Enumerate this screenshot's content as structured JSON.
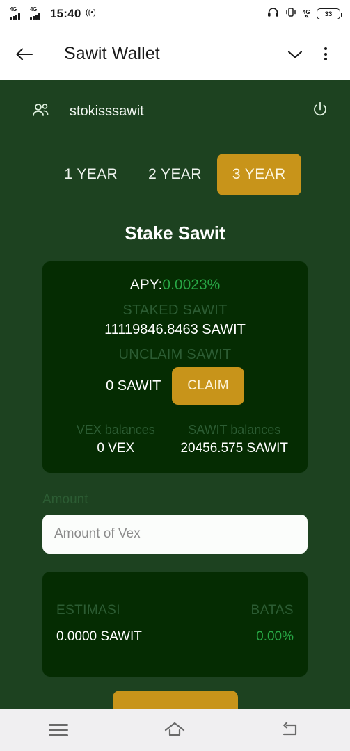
{
  "statusbar": {
    "network_label_1": "4G",
    "network_label_2": "4G",
    "time": "15:40",
    "wifi_icon": "hotspot-icon",
    "headset_icon": "headset-icon",
    "vibrate_icon": "vibrate-icon",
    "data_label": "4G",
    "battery_level": "33"
  },
  "appbar": {
    "back_icon": "back-arrow-icon",
    "title": "Sawit Wallet",
    "chevron_icon": "chevron-down-icon",
    "menu_icon": "kebab-menu-icon"
  },
  "account": {
    "people_icon": "people-icon",
    "name": "stokisssawit",
    "power_icon": "power-icon"
  },
  "tabs": [
    {
      "label": "1 YEAR",
      "active": false
    },
    {
      "label": "2 YEAR",
      "active": false
    },
    {
      "label": "3 YEAR",
      "active": true
    }
  ],
  "section_title": "Stake Sawit",
  "stake_card": {
    "apy_label": "APY:",
    "apy_value": "0.0023%",
    "staked_label": "STAKED SAWIT",
    "staked_value": "11119846.8463 SAWIT",
    "unclaim_label": "UNCLAIM SAWIT",
    "unclaim_value": "0 SAWIT",
    "claim_button": "CLAIM",
    "vex_balance_label": "VEX balances",
    "vex_balance_value": "0 VEX",
    "sawit_balance_label": "SAWIT balances",
    "sawit_balance_value": "20456.575 SAWIT"
  },
  "amount": {
    "label": "Amount",
    "value": "",
    "placeholder": "Amount of Vex"
  },
  "estimation_card": {
    "estimasi_label": "ESTIMASI",
    "estimasi_value": "0.0000 SAWIT",
    "batas_label": "BATAS",
    "batas_value": "0.00%"
  },
  "submit": {
    "label": ""
  },
  "navbar": {
    "recents_icon": "recents-icon",
    "home_icon": "home-icon",
    "back_icon": "back-icon"
  },
  "colors": {
    "background": "#1d4220",
    "card": "#052c02",
    "accent_gold": "#c8941a",
    "green_value": "#28a745",
    "dim_label": "#2c5c33"
  }
}
